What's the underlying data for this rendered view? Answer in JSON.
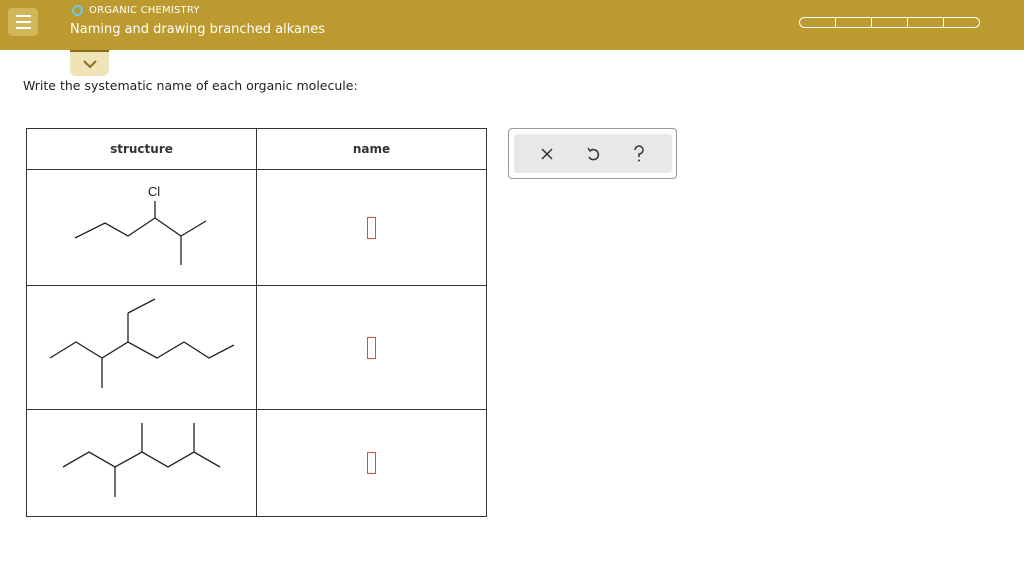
{
  "header": {
    "topic": "ORGANIC CHEMISTRY",
    "lesson_title": "Naming and drawing branched alkanes",
    "progress_segments": 5
  },
  "question": {
    "prompt": "Write the systematic name of each organic molecule:",
    "columns": [
      "structure",
      "name"
    ],
    "rows": [
      {
        "atom_label": "Cl",
        "answer": ""
      },
      {
        "answer": ""
      },
      {
        "answer": ""
      }
    ]
  },
  "toolbox": {
    "icons": [
      "close-icon",
      "undo-icon",
      "help-icon"
    ]
  },
  "colors": {
    "header_bg": "#bd9a2f",
    "answer_box_border": "#e04a3a",
    "topic_circle": "#6dc8f0"
  }
}
